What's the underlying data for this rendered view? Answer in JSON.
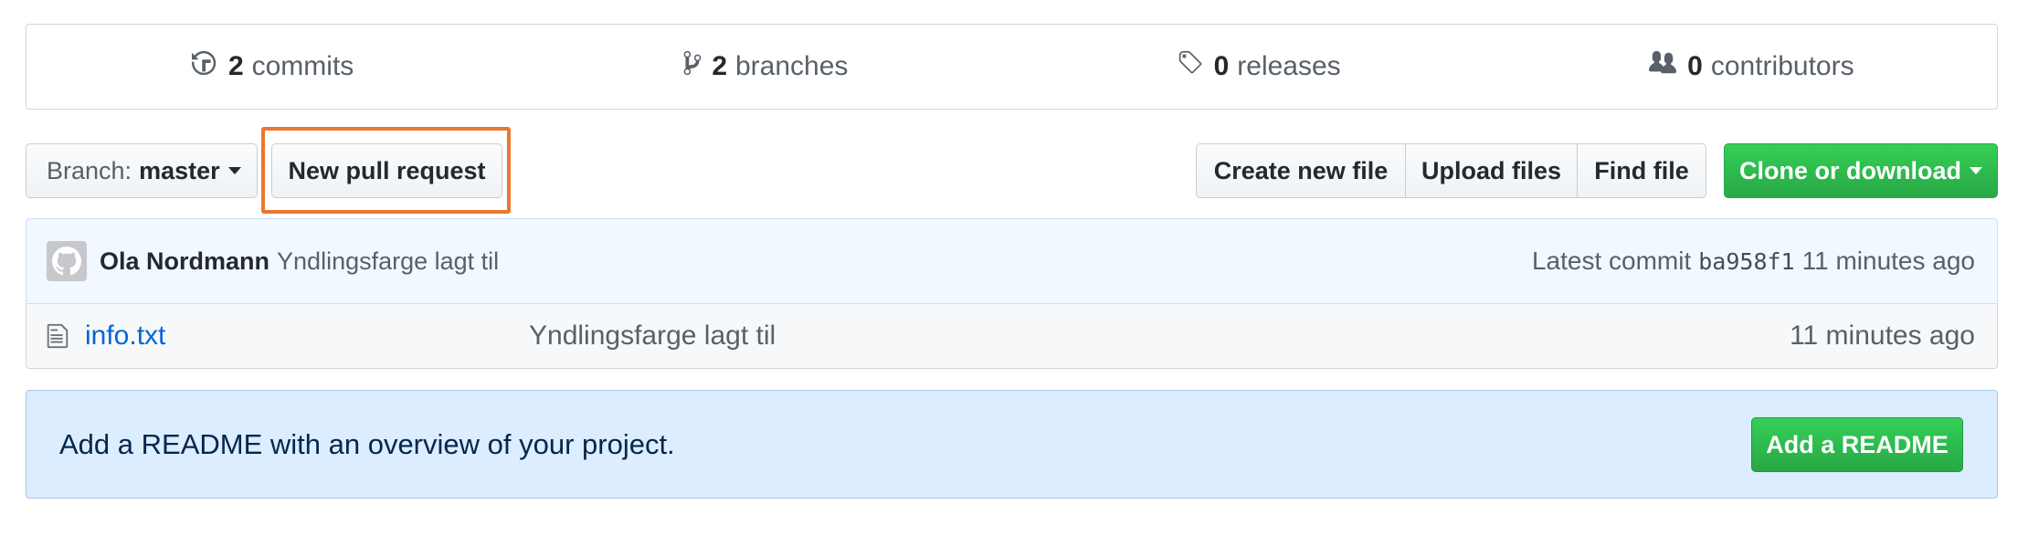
{
  "summary": {
    "commits": {
      "count": "2",
      "label": "commits"
    },
    "branches": {
      "count": "2",
      "label": "branches"
    },
    "releases": {
      "count": "0",
      "label": "releases"
    },
    "contributors": {
      "count": "0",
      "label": "contributors"
    }
  },
  "toolbar": {
    "branch_prefix": "Branch:",
    "branch_name": "master",
    "new_pull_request": "New pull request",
    "create_new_file": "Create new file",
    "upload_files": "Upload files",
    "find_file": "Find file",
    "clone_or_download": "Clone or download"
  },
  "latest_commit": {
    "author": "Ola Nordmann",
    "message": "Yndlingsfarge lagt til",
    "label": "Latest commit",
    "sha": "ba958f1",
    "age": "11 minutes ago"
  },
  "files": [
    {
      "name": "info.txt",
      "message": "Yndlingsfarge lagt til",
      "age": "11 minutes ago"
    }
  ],
  "readme_prompt": {
    "text": "Add a README with an overview of your project.",
    "button": "Add a README"
  },
  "colors": {
    "highlight": "#e9772f",
    "primary_green": "#28a745",
    "link_blue": "#0366d6",
    "commit_bg": "#f1f8ff",
    "readme_bg": "#dbedff"
  },
  "icons": [
    "history-icon",
    "git-branch-icon",
    "tag-icon",
    "people-icon",
    "octocat-avatar",
    "file-text-icon"
  ]
}
